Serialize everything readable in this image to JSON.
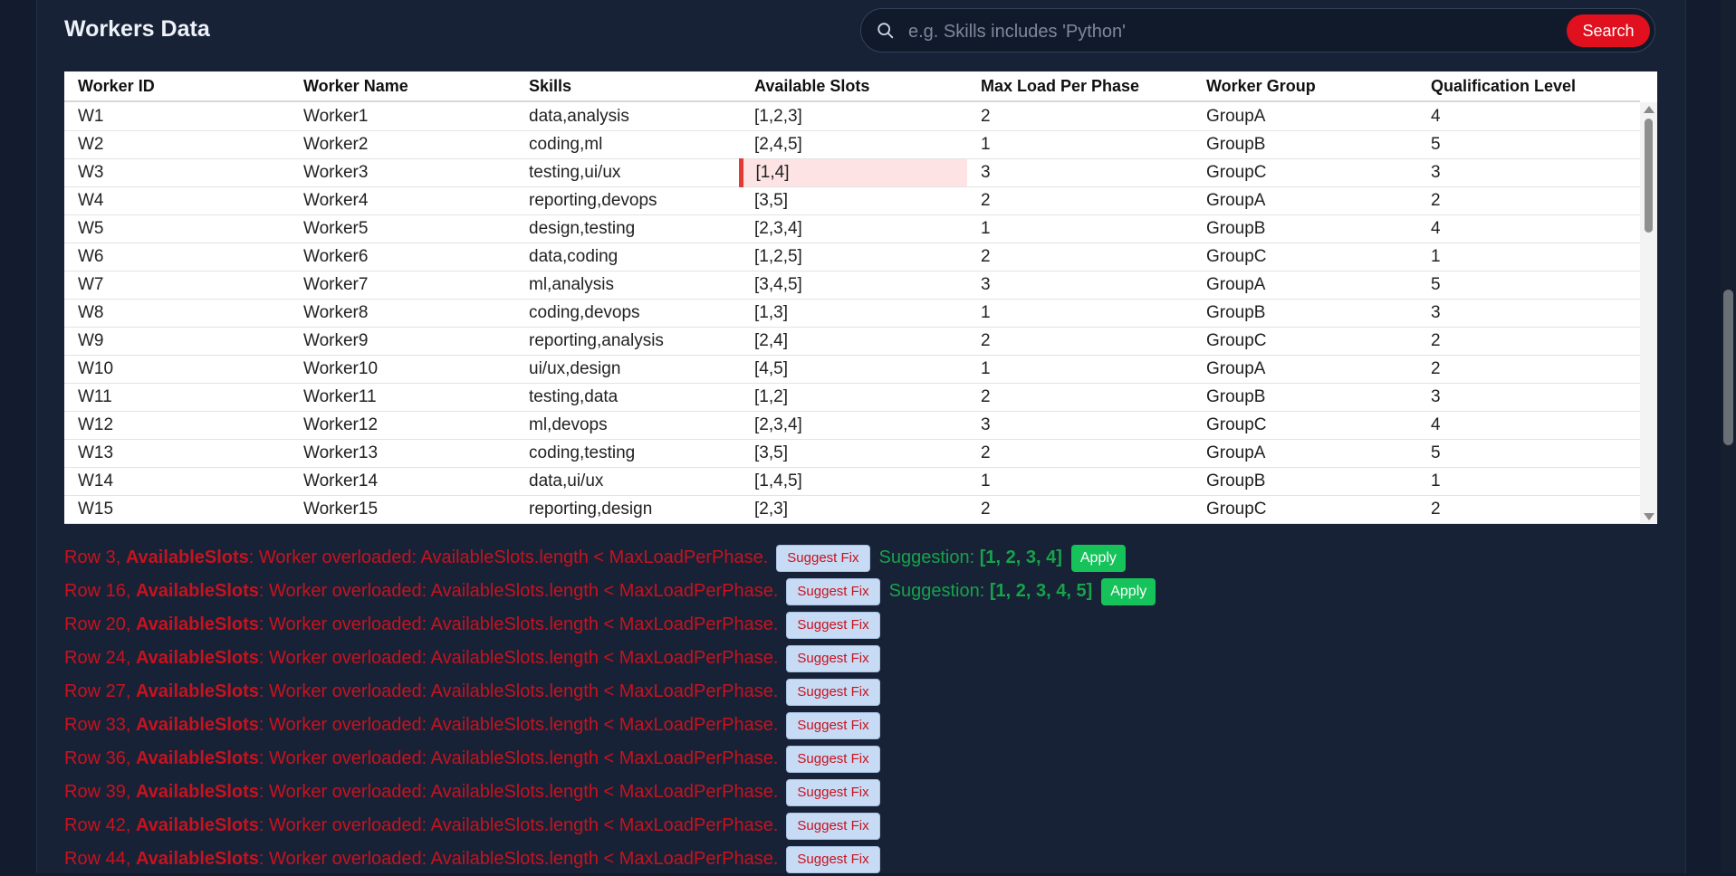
{
  "header": {
    "title": "Workers Data",
    "search_placeholder": "e.g. Skills includes 'Python'",
    "search_button": "Search"
  },
  "table": {
    "columns": [
      "Worker ID",
      "Worker Name",
      "Skills",
      "Available Slots",
      "Max Load Per Phase",
      "Worker Group",
      "Qualification Level"
    ],
    "rows": [
      [
        "W1",
        "Worker1",
        "data,analysis",
        "[1,2,3]",
        "2",
        "GroupA",
        "4"
      ],
      [
        "W2",
        "Worker2",
        "coding,ml",
        "[2,4,5]",
        "1",
        "GroupB",
        "5"
      ],
      [
        "W3",
        "Worker3",
        "testing,ui/ux",
        "[1,4]",
        "3",
        "GroupC",
        "3"
      ],
      [
        "W4",
        "Worker4",
        "reporting,devops",
        "[3,5]",
        "2",
        "GroupA",
        "2"
      ],
      [
        "W5",
        "Worker5",
        "design,testing",
        "[2,3,4]",
        "1",
        "GroupB",
        "4"
      ],
      [
        "W6",
        "Worker6",
        "data,coding",
        "[1,2,5]",
        "2",
        "GroupC",
        "1"
      ],
      [
        "W7",
        "Worker7",
        "ml,analysis",
        "[3,4,5]",
        "3",
        "GroupA",
        "5"
      ],
      [
        "W8",
        "Worker8",
        "coding,devops",
        "[1,3]",
        "1",
        "GroupB",
        "3"
      ],
      [
        "W9",
        "Worker9",
        "reporting,analysis",
        "[2,4]",
        "2",
        "GroupC",
        "2"
      ],
      [
        "W10",
        "Worker10",
        "ui/ux,design",
        "[4,5]",
        "1",
        "GroupA",
        "2"
      ],
      [
        "W11",
        "Worker11",
        "testing,data",
        "[1,2]",
        "2",
        "GroupB",
        "3"
      ],
      [
        "W12",
        "Worker12",
        "ml,devops",
        "[2,3,4]",
        "3",
        "GroupC",
        "4"
      ],
      [
        "W13",
        "Worker13",
        "coding,testing",
        "[3,5]",
        "2",
        "GroupA",
        "5"
      ],
      [
        "W14",
        "Worker14",
        "data,ui/ux",
        "[1,4,5]",
        "1",
        "GroupB",
        "1"
      ],
      [
        "W15",
        "Worker15",
        "reporting,design",
        "[2,3]",
        "2",
        "GroupC",
        "2"
      ]
    ],
    "flagged_cell": {
      "row": 2,
      "col": 3
    }
  },
  "errors": {
    "field": "AvailableSlots",
    "message": ": Worker overloaded: AvailableSlots.length < MaxLoadPerPhase.",
    "suggest_label": "Suggest Fix",
    "suggestion_label": "Suggestion:",
    "apply_label": "Apply",
    "items": [
      {
        "row_label": "Row 3, ",
        "suggestion": "[1, 2, 3, 4]"
      },
      {
        "row_label": "Row 16, ",
        "suggestion": "[1, 2, 3, 4, 5]"
      },
      {
        "row_label": "Row 20, "
      },
      {
        "row_label": "Row 24, "
      },
      {
        "row_label": "Row 27, "
      },
      {
        "row_label": "Row 33, "
      },
      {
        "row_label": "Row 36, "
      },
      {
        "row_label": "Row 39, "
      },
      {
        "row_label": "Row 42, "
      },
      {
        "row_label": "Row 44, "
      }
    ]
  },
  "colors": {
    "background": "#131c2e",
    "panel": "#172236",
    "accent_red": "#e0101e",
    "error_text": "#c8121e",
    "suggestion_green": "#16a34a",
    "apply_green": "#16c25a",
    "highlight_cell": "#fde3e3"
  }
}
